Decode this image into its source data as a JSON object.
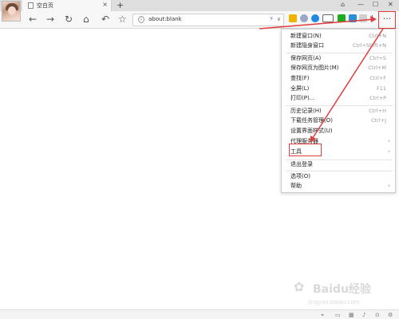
{
  "tab": {
    "title": "空白页",
    "close": "×"
  },
  "new_tab": "+",
  "window_controls": [
    "⌂",
    "—",
    "☐",
    "✕"
  ],
  "nav": {
    "back": "←",
    "forward": "→",
    "reload": "↻",
    "home": "⌂",
    "undo": "↶",
    "favorite": "☆"
  },
  "address": {
    "url": "about:blank",
    "caret": "∨"
  },
  "download_icon": "↓",
  "menu_button": "···",
  "menu": {
    "items": [
      {
        "label": "新建窗口(N)",
        "shortcut": "Ctrl+N"
      },
      {
        "label": "新建隐身窗口",
        "shortcut": "Ctrl+Shift+N"
      },
      {
        "label": "保存网页(A)",
        "shortcut": "Ctrl+S"
      },
      {
        "label": "保存网页为图片(M)",
        "shortcut": "Ctrl+M"
      },
      {
        "label": "查找(F)",
        "shortcut": "Ctrl+F"
      },
      {
        "label": "全屏(L)",
        "shortcut": "F11"
      },
      {
        "label": "打印(P)...",
        "shortcut": "Ctrl+P"
      },
      {
        "label": "历史记录(H)",
        "shortcut": "Ctrl+H"
      },
      {
        "label": "下载任务管理(O)",
        "shortcut": "Ctrl+J"
      },
      {
        "label": "设置界面样式(U)",
        "shortcut": ""
      },
      {
        "label": "代理服务器",
        "shortcut": ""
      },
      {
        "label": "工具",
        "shortcut": ""
      },
      {
        "label": "退出登录",
        "shortcut": ""
      },
      {
        "label": "选项(O)",
        "shortcut": ""
      },
      {
        "label": "帮助",
        "shortcut": ""
      }
    ],
    "submenu_arrow": "›"
  },
  "colors": {
    "highlight_red": "#e23c3c",
    "accent_blue": "#3a7bd5"
  },
  "watermark": {
    "paw": "✿",
    "name": "Baidu经验",
    "site": "jingyan.baidu.com"
  }
}
